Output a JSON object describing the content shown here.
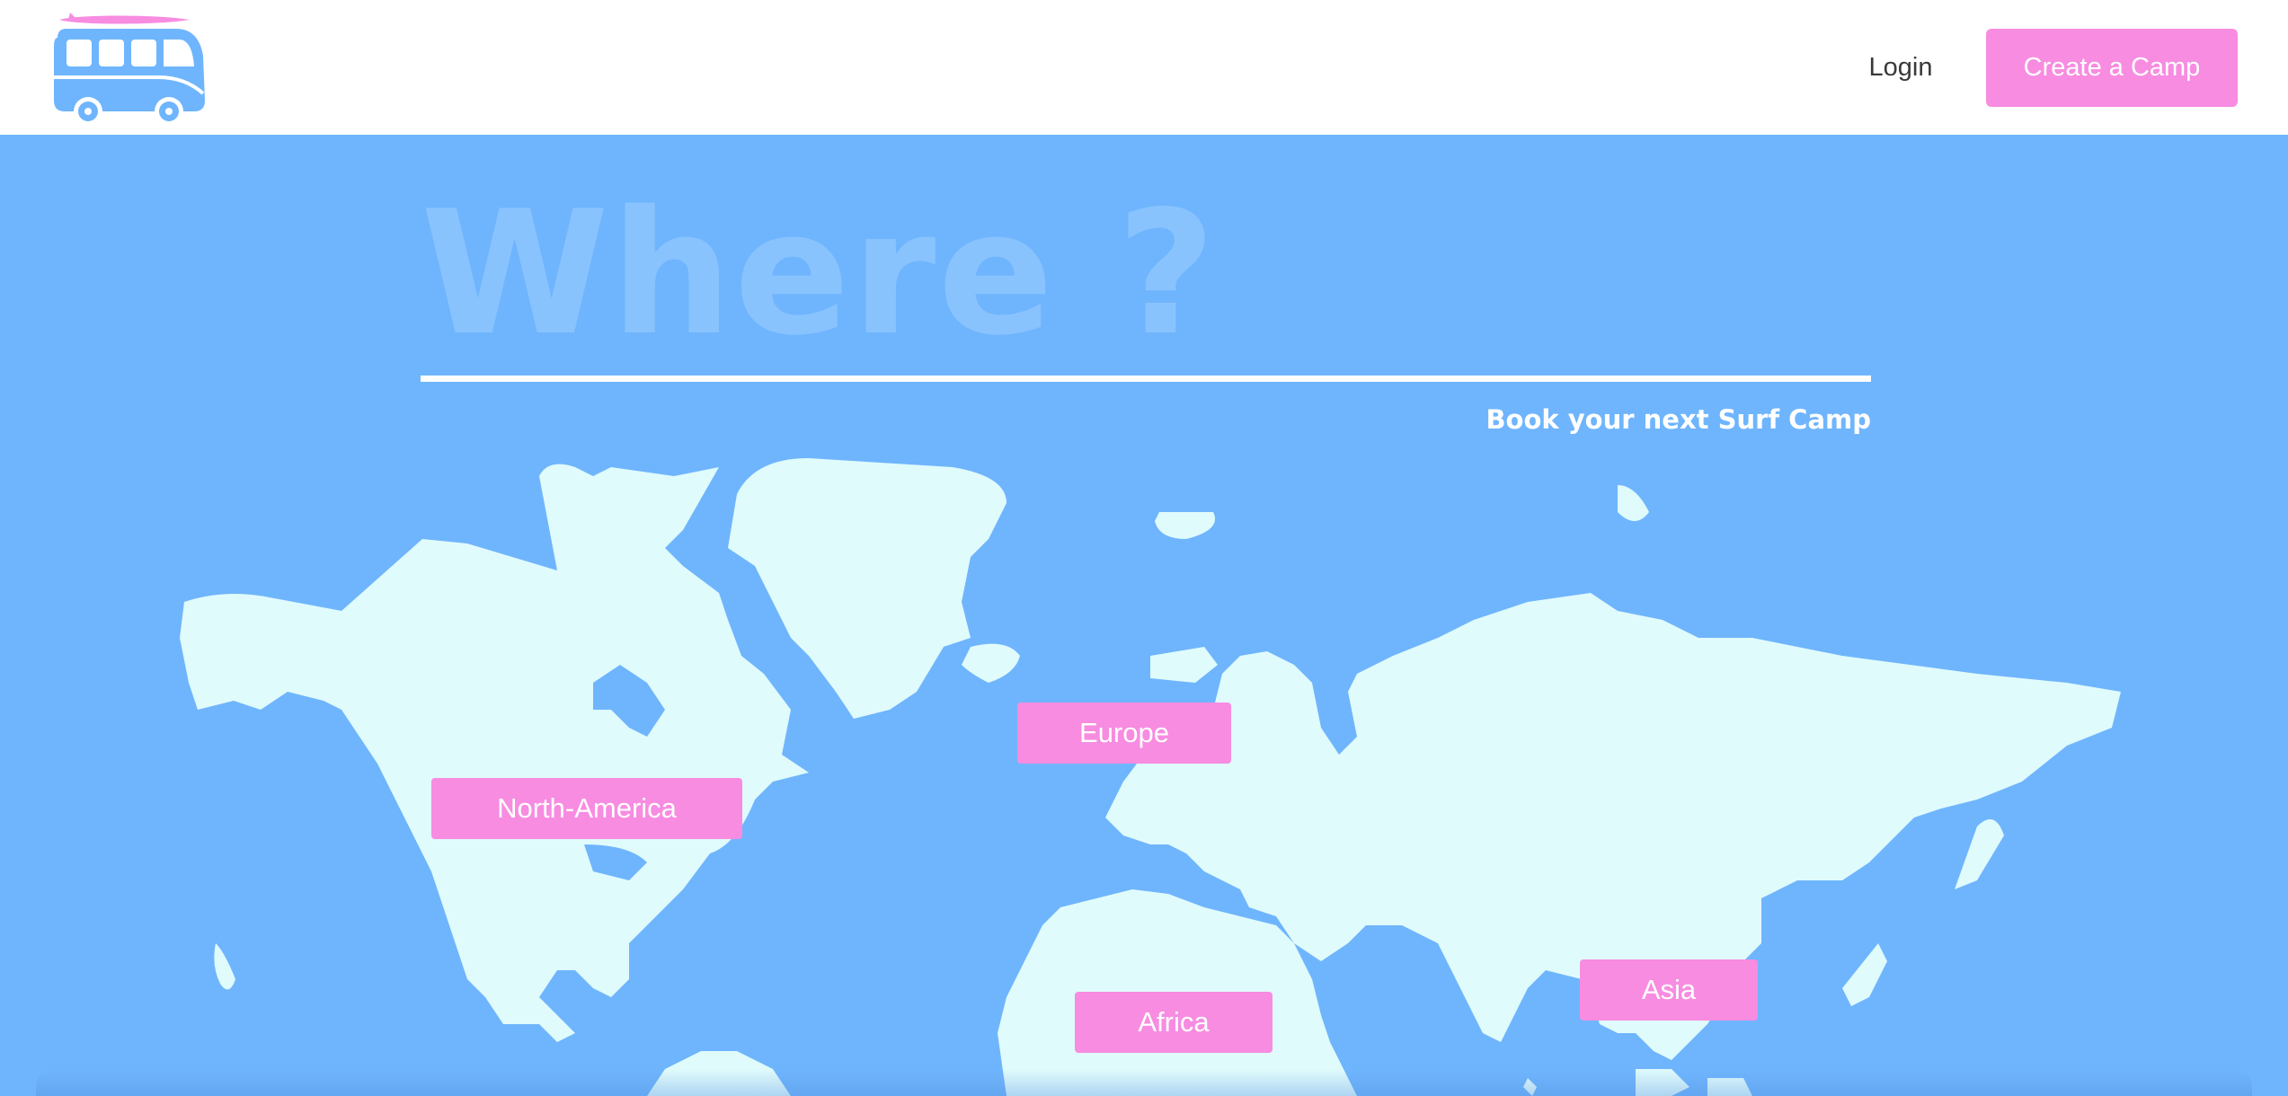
{
  "header": {
    "logo_icon": "surf-van-icon",
    "login_label": "Login",
    "create_camp_label": "Create a Camp"
  },
  "hero": {
    "title": "Where ?",
    "subtitle": "Book your next Surf Camp"
  },
  "regions": {
    "north_america": "North-America",
    "europe": "Europe",
    "africa": "Africa",
    "asia": "Asia"
  },
  "colors": {
    "accent_pink": "#f78ce1",
    "sky_blue": "#6fb5fd",
    "land": "#e0fbfc",
    "title_faded": "#89c3fe",
    "header_bg": "#ffffff"
  }
}
